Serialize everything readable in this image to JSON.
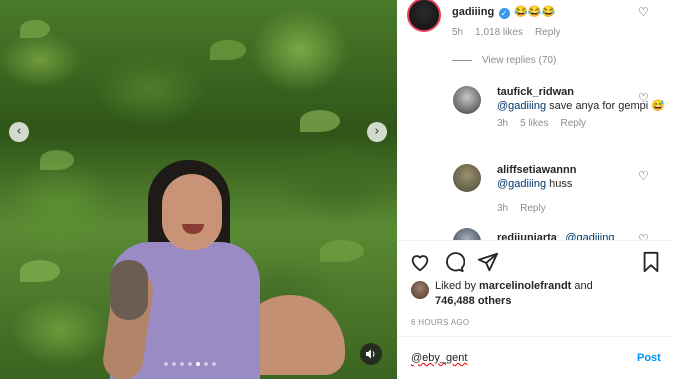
{
  "post": {
    "media": {
      "nav_prev_icon": "chevron-left-icon",
      "nav_next_icon": "chevron-right-icon",
      "audio_icon": "speaker-icon",
      "carousel": {
        "count": 7,
        "active_index": 4
      }
    }
  },
  "comments": {
    "main": {
      "username": "gadiiing",
      "verified": true,
      "text": "😂😂😂",
      "time": "5h",
      "likes": "1,018 likes",
      "reply_label": "Reply"
    },
    "view_replies": "View replies (70)",
    "replies": [
      {
        "username": "taufick_ridwan",
        "mention": "@gadiiing",
        "text": " save anya for gempi 😅",
        "time": "3h",
        "likes": "5 likes",
        "reply_label": "Reply"
      },
      {
        "username": "aliffsetiawannn",
        "mention": "@gadiiing",
        "text": " huss",
        "time": "3h",
        "likes": "",
        "reply_label": "Reply"
      },
      {
        "username": "rediiunjarta",
        "mention": "@gadiiing",
        "text": "",
        "time": "",
        "likes": "",
        "reply_label": ""
      }
    ]
  },
  "actions": {
    "like_icon": "heart-icon",
    "comment_icon": "comment-icon",
    "share_icon": "send-icon",
    "save_icon": "bookmark-icon"
  },
  "likes": {
    "prefix": "Liked by ",
    "user": "marcelinolefrandt",
    "middle": " and",
    "count": "746,488 others"
  },
  "timestamp": "6 HOURS AGO",
  "composer": {
    "value": "@eby_gent",
    "post_label": "Post"
  },
  "colors": {
    "accent_blue": "#0095f6",
    "verified_blue": "#3897f0",
    "story_ring": "#e4405f",
    "muted": "#8e8e8e"
  }
}
